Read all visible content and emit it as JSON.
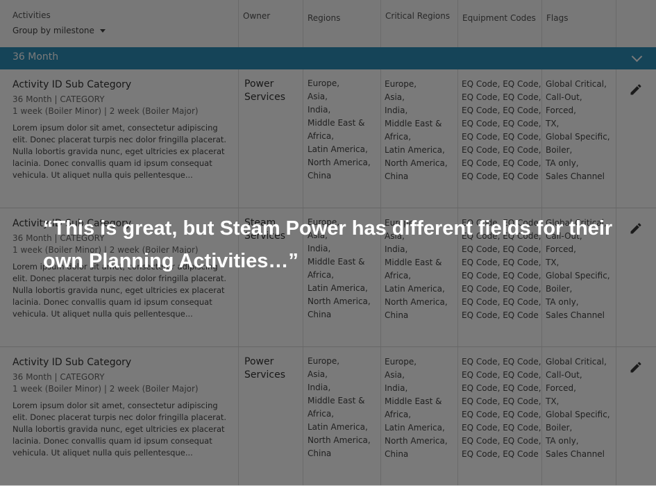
{
  "header": {
    "activities_label": "Activities",
    "group_by_label": "Group by milestone",
    "columns": {
      "owner": "Owner",
      "regions": "Regions",
      "critical_regions": "Critical Regions",
      "equipment_codes": "Equipment Codes",
      "flags": "Flags"
    }
  },
  "group": {
    "title": "36 Month",
    "icon": "chevron-down-icon"
  },
  "rows": [
    {
      "title": "Activity ID Sub Category",
      "meta": "36 Month | CATEGORY",
      "duration": "1 week (Boiler Minor) | 2 week (Boiler Major)",
      "description": "Lorem ipsum dolor sit amet, consectetur adipiscing elit. Donec placerat turpis nec dolor fringilla placerat. Nulla lobortis gravida nunc, eget ultricies ex placerat lacinia. Donec convallis quam id ipsum consequat vehicula. Ut aliquet nulla quis pellentesque...",
      "owner": "Power Services",
      "regions": [
        "Europe,",
        "Asia,",
        "India,",
        "Middle East &",
        "Africa,",
        "Latin America,",
        "North America,",
        "China"
      ],
      "critical_regions": [
        "Europe,",
        "Asia,",
        "India,",
        "Middle East &",
        "Africa,",
        "Latin America,",
        "North America,",
        "China"
      ],
      "equipment_codes": [
        "EQ Code, EQ Code,",
        "EQ Code, EQ Code,",
        "EQ Code, EQ Code,",
        "EQ Code, EQ Code,",
        "EQ Code, EQ Code,",
        "EQ Code, EQ Code,",
        "EQ Code, EQ Code,",
        "EQ Code, EQ Code"
      ],
      "flags": [
        "Global Critical,",
        "Call-Out,",
        "Forced,",
        "TX,",
        "Global Specific,",
        "Boiler,",
        "TA only,",
        "Sales Channel"
      ]
    },
    {
      "title": "Activity ID Sub Category",
      "meta": "36 Month | CATEGORY",
      "duration": "1 week (Boiler Minor) | 2 week (Boiler Major)",
      "description": "Lorem ipsum dolor sit amet, consectetur adipiscing elit. Donec placerat turpis nec dolor fringilla placerat. Nulla lobortis gravida nunc, eget ultricies ex placerat lacinia. Donec convallis quam id ipsum consequat vehicula. Ut aliquet nulla quis pellentesque...",
      "owner": "Steam Services",
      "regions": [
        "Europe,",
        "Asia,",
        "India,",
        "Middle East &",
        "Africa,",
        "Latin America,",
        "North America,",
        "China"
      ],
      "critical_regions": [
        "Europe,",
        "Asia,",
        "India,",
        "Middle East &",
        "Africa,",
        "Latin America,",
        "North America,",
        "China"
      ],
      "equipment_codes": [
        "EQ Code, EQ Code,",
        "EQ Code, EQ Code,",
        "EQ Code, EQ Code,",
        "EQ Code, EQ Code,",
        "EQ Code, EQ Code,",
        "EQ Code, EQ Code,",
        "EQ Code, EQ Code,",
        "EQ Code, EQ Code"
      ],
      "flags": [
        "Global Critical,",
        "Call-Out,",
        "Forced,",
        "TX,",
        "Global Specific,",
        "Boiler,",
        "TA only,",
        "Sales Channel"
      ]
    },
    {
      "title": "Activity ID Sub Category",
      "meta": "36 Month | CATEGORY",
      "duration": "1 week (Boiler Minor) | 2 week (Boiler Major)",
      "description": "Lorem ipsum dolor sit amet, consectetur adipiscing elit. Donec placerat turpis nec dolor fringilla placerat. Nulla lobortis gravida nunc, eget ultricies ex placerat lacinia. Donec convallis quam id ipsum consequat vehicula. Ut aliquet nulla quis pellentesque...",
      "owner": "Power Services",
      "regions": [
        "Europe,",
        "Asia,",
        "India,",
        "Middle East &",
        "Africa,",
        "Latin America,",
        "North America,",
        "China"
      ],
      "critical_regions": [
        "Europe,",
        "Asia,",
        "India,",
        "Middle East &",
        "Africa,",
        "Latin America,",
        "North America,",
        "China"
      ],
      "equipment_codes": [
        "EQ Code, EQ Code,",
        "EQ Code, EQ Code,",
        "EQ Code, EQ Code,",
        "EQ Code, EQ Code,",
        "EQ Code, EQ Code,",
        "EQ Code, EQ Code,",
        "EQ Code, EQ Code,",
        "EQ Code, EQ Code"
      ],
      "flags": [
        "Global Critical,",
        "Call-Out,",
        "Forced,",
        "TX,",
        "Global Specific,",
        "Boiler,",
        "TA only,",
        "Sales Channel"
      ]
    }
  ],
  "overlay": {
    "quote": "“This is great, but Steam Power has different fields for their own Planning Activities…”"
  },
  "colors": {
    "group_bar": "#2d8eb8",
    "overlay": "#000000"
  },
  "icons": {
    "row_action": "pencil-edit-icon"
  }
}
